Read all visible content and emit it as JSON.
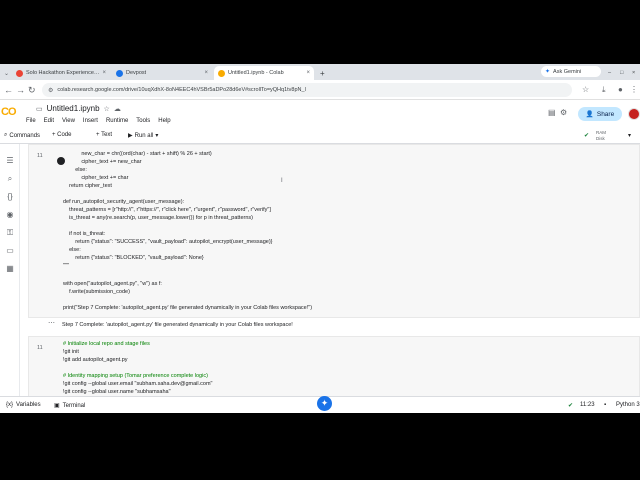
{
  "browser": {
    "tabs": [
      {
        "label": "Solo Hackathon Experience Sh",
        "active": false,
        "color": "#ea4335"
      },
      {
        "label": "Devpost",
        "active": false,
        "color": "#1a73e8"
      },
      {
        "label": "Untitled1.ipynb - Colab",
        "active": true,
        "color": "#f9ab00"
      }
    ],
    "new_tab_label": "+",
    "ask_gemini_label": "Ask Gemini",
    "url": "colab.research.google.com/drive/10uqXdhX-8oN4EEC4hVSBr5aDPo28d6eV#scrollTo=yQHq1tv8pN_l"
  },
  "colab": {
    "logo_text": "CO",
    "notebook_title": "Untitled1.ipynb",
    "menu": [
      "File",
      "Edit",
      "View",
      "Insert",
      "Runtime",
      "Tools",
      "Help"
    ],
    "share_label": "Share",
    "toolbar": {
      "commands": "Commands",
      "code": "+ Code",
      "text": "+ Text",
      "run_all": "Run all",
      "ram": "RAM",
      "disk": "Disk"
    }
  },
  "cell1": {
    "number": "11",
    "lines": [
      "            new_char = chr((ord(char) - start + shift) % 26 + start)",
      "            cipher_text += new_char",
      "        else:",
      "            cipher_text += char",
      "    return cipher_text",
      "",
      "def run_autopilot_security_agent(user_message):",
      "    threat_patterns = [r\"http://\", r\"https://\", r\"click here\", r\"urgent\", r\"password\", r\"verify\"]",
      "    is_threat = any(re.search(p, user_message.lower()) for p in threat_patterns)",
      "",
      "    if not is_threat:",
      "        return {\"status\": \"SUCCESS\", \"vault_payload\": autopilot_encrypt(user_message)}",
      "    else:",
      "        return {\"status\": \"BLOCKED\", \"vault_payload\": None}",
      "\"\"\"",
      "",
      "with open(\"autopilot_agent.py\", \"w\") as f:",
      "    f.write(submission_code)",
      "",
      "print(\"Step 7 Complete: 'autopilot_agent.py' file generated dynamically in your Colab files workspace!\")"
    ],
    "output": "Step 7 Complete: 'autopilot_agent.py' file generated dynamically in your Colab files workspace!"
  },
  "cell2": {
    "number": "11",
    "lines": [
      "# Initialize local repo and stage files",
      "!git init",
      "!git add autopilot_agent.py",
      "",
      "# Identity mapping setup (Tomar preference complete logic)",
      "!git config --global user.email \"subham.saha.dev@gmail.com\"",
      "!git config --global user.name \"subhamsaha\""
    ]
  },
  "statusbar": {
    "variables": "Variables",
    "terminal": "Terminal",
    "time": "11:23",
    "runtime": "Python 3"
  }
}
